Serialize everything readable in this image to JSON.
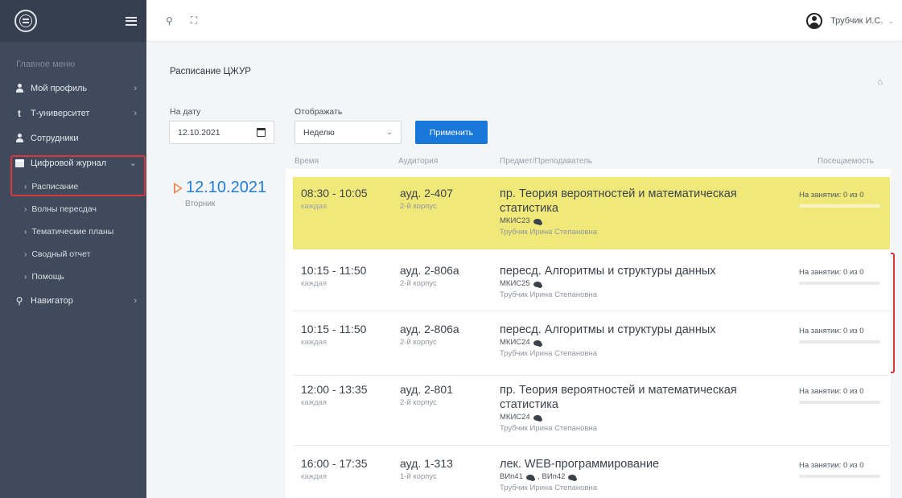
{
  "sidebar": {
    "section_title": "Главное меню",
    "items": [
      {
        "label": "Мой профиль"
      },
      {
        "label": "Т-университет"
      },
      {
        "label": "Сотрудники"
      },
      {
        "label": "Цифровой журнал"
      },
      {
        "label": "Навигатор"
      }
    ],
    "subitems": [
      {
        "label": "Расписание"
      },
      {
        "label": "Волны пересдач"
      },
      {
        "label": "Тематические планы"
      },
      {
        "label": "Сводный отчет"
      },
      {
        "label": "Помощь"
      }
    ]
  },
  "topbar": {
    "user_name": "Трубчик И.С."
  },
  "page": {
    "title": "Расписание ЦЖУР",
    "date_label": "На дату",
    "date_value": "12.10.2021",
    "display_label": "Отображать",
    "display_value": "Неделю",
    "apply_button": "Применить"
  },
  "table": {
    "headers": {
      "time": "Время",
      "room": "Аудитория",
      "subject": "Предмет/Преподаватель",
      "attendance": "Посещаемость"
    },
    "day": {
      "date": "12.10.2021",
      "weekday": "Вторник"
    },
    "rows": [
      {
        "time": "08:30 - 10:05",
        "freq": "каждая",
        "room": "ауд. 2-407",
        "building": "2-й корпус",
        "subject": "пр. Теория вероятностей и математическая статистика",
        "group": "МКИС23",
        "teacher": "Трубчик Ирина Степановна",
        "attendance": "На занятии: 0 из 0",
        "highlight": "#f0e97a"
      },
      {
        "time": "10:15 - 11:50",
        "freq": "каждая",
        "room": "ауд. 2-806а",
        "building": "2-й корпус",
        "subject": "пересд. Алгоритмы и структуры данных",
        "group": "МКИС25",
        "teacher": "Трубчик Ирина Степановна",
        "attendance": "На занятии: 0 из 0"
      },
      {
        "time": "10:15 - 11:50",
        "freq": "каждая",
        "room": "ауд. 2-806а",
        "building": "2-й корпус",
        "subject": "пересд. Алгоритмы и структуры данных",
        "group": "МКИС24",
        "teacher": "Трубчик Ирина Степановна",
        "attendance": "На занятии: 0 из 0"
      },
      {
        "time": "12:00 - 13:35",
        "freq": "каждая",
        "room": "ауд. 2-801",
        "building": "2-й корпус",
        "subject": "пр. Теория вероятностей и математическая статистика",
        "group": "МКИС24",
        "teacher": "Трубчик Ирина Степановна",
        "attendance": "На занятии: 0 из 0"
      },
      {
        "time": "16:00 - 17:35",
        "freq": "каждая",
        "room": "ауд. 1-313",
        "building": "1-й корпус",
        "subject": "лек. WEB-программирование",
        "group1": "ВИп41",
        "group_sep": ",",
        "group2": "ВИп42",
        "teacher": "Трубчик Ирина Степановна",
        "attendance": "На занятии: 0 из 0"
      }
    ]
  },
  "colors": {
    "sidebar_bg": "#3f4a5c",
    "accent_blue": "#1877d8",
    "highlight_yellow": "#f0e97a",
    "annotation_red": "#d9373c"
  }
}
